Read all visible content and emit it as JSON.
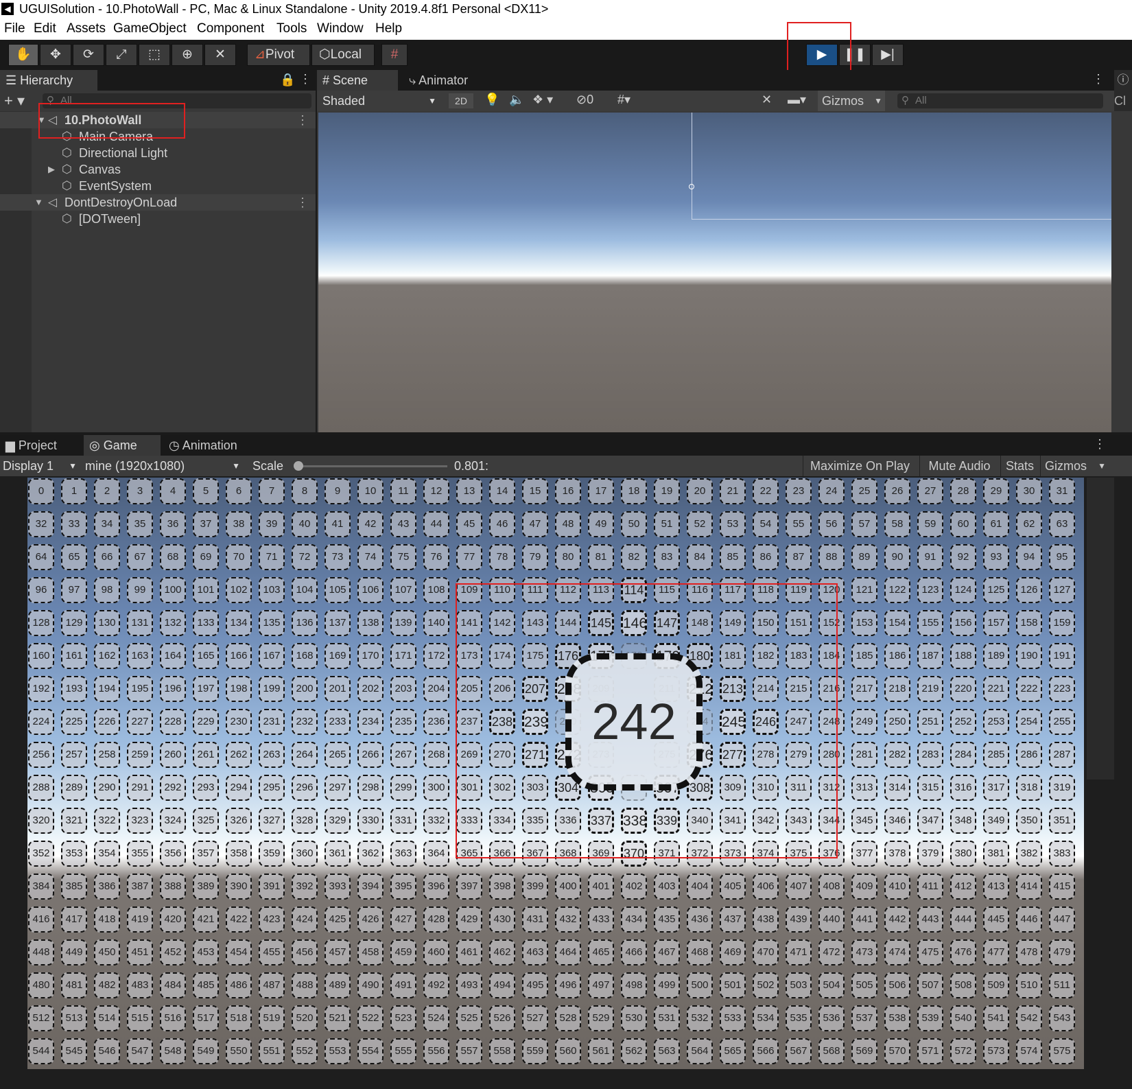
{
  "titlebar": {
    "title": "UGUISolution - 10.PhotoWall - PC, Mac & Linux Standalone - Unity 2019.4.8f1 Personal <DX11>"
  },
  "menu": [
    "File",
    "Edit",
    "Assets",
    "GameObject",
    "Component",
    "Tools",
    "Window",
    "Help"
  ],
  "toolbar": {
    "tools": [
      "hand-icon",
      "move-icon",
      "rotate-icon",
      "scale-icon",
      "rect-icon",
      "transform-icon",
      "custom-tool-icon"
    ],
    "pivot_label": "Pivot",
    "local_label": "Local"
  },
  "hierarchy": {
    "tab": "Hierarchy",
    "search_placeholder": "All",
    "items": [
      {
        "label": "10.PhotoWall",
        "type": "scene"
      },
      {
        "label": "Main Camera",
        "type": "object"
      },
      {
        "label": "Directional Light",
        "type": "object"
      },
      {
        "label": "Canvas",
        "type": "object"
      },
      {
        "label": "EventSystem",
        "type": "object"
      },
      {
        "label": "DontDestroyOnLoad",
        "type": "scene"
      },
      {
        "label": "[DOTween]",
        "type": "object"
      }
    ]
  },
  "scene": {
    "tabs": [
      "Scene",
      "Animator"
    ],
    "shading": "Shaded",
    "mode_2d": "2D",
    "hidden_count": "0",
    "gizmos": "Gizmos",
    "search_placeholder": "All",
    "inspector_stub": "Cl"
  },
  "bottom": {
    "tabs": [
      "Project",
      "Game",
      "Animation"
    ],
    "display": "Display 1",
    "resolution": "mine (1920x1080)",
    "scale_label": "Scale",
    "scale_value": "0.801:",
    "toggles": [
      "Maximize On Play",
      "Mute Audio",
      "Stats",
      "Gizmos"
    ]
  },
  "photowall": {
    "columns": 32,
    "rows": 18,
    "focus_label": "242"
  },
  "colors": {
    "highlight": "#e02020",
    "play_active": "#1a4f86"
  }
}
